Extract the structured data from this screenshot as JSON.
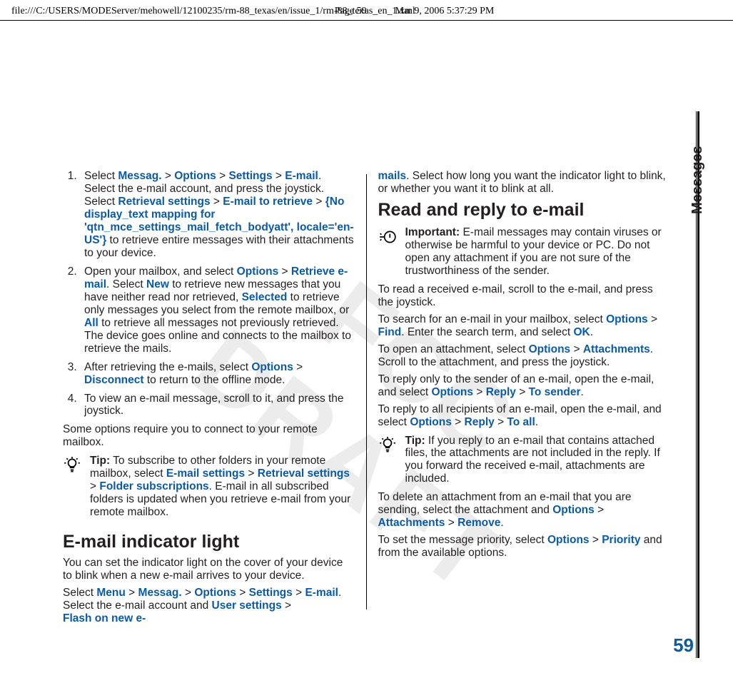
{
  "header": {
    "file_path": "file:///C:/USERS/MODEServer/mehowell/12100235/rm-88_texas/en/issue_1/rm-88_texas_en_1.xml",
    "page": "Page 59",
    "datetime": "Mar 9, 2006 5:37:29 PM"
  },
  "sidetab": "Messages",
  "page_number": "59",
  "watermark": "FCC DRAFT",
  "left_col": {
    "ol": [
      {
        "lead": "Select ",
        "path1": [
          "Messag.",
          "Options",
          "Settings",
          "E-mail"
        ],
        "after_path1": ". Select the e-mail account, and press the joystick. Select ",
        "path2": [
          "Retrieval settings",
          "E-mail to retrieve",
          "{No display_text mapping for 'qtn_mce_settings_mail_fetch_bodyatt', locale='en-US'}"
        ],
        "after_path2": " to retrieve entire messages with their attachments to your device."
      },
      {
        "lead": "Open your mailbox, and select ",
        "path1": [
          "Options",
          "Retrieve e-mail"
        ],
        "after_path1": ". Select ",
        "opt_new": "New",
        "after_new": " to retrieve new messages that you have neither read nor retrieved, ",
        "opt_sel": "Selected",
        "after_sel": " to retrieve only messages you select from the remote mailbox, or ",
        "opt_all": "All",
        "after_all": " to retrieve all messages not previously retrieved. The device goes online and connects to the mailbox to retrieve the mails."
      },
      {
        "lead": "After retrieving the e-mails, select ",
        "path1": [
          "Options",
          "Disconnect"
        ],
        "after_path1": " to return to the offline mode."
      },
      {
        "plain": "To view an e-mail message, scroll to it, and press the joystick."
      }
    ],
    "para_after_ol": "Some options require you to connect to your remote mailbox.",
    "tip": {
      "label": "Tip:",
      "before": " To subscribe to other folders in your remote mailbox, select ",
      "path": [
        "E-mail settings",
        "Retrieval settings",
        "Folder subscriptions"
      ],
      "after": ". E-mail in all subscribed folders is updated when you retrieve e-mail from your remote mailbox."
    },
    "sect2_title": "E-mail indicator light",
    "sect2_p1": "You can set the indicator light on the cover of your device to blink when a new e-mail arrives to your device.",
    "sect2_lead": "Select ",
    "sect2_path1": [
      "Menu",
      "Messag.",
      "Options",
      "Settings",
      "E-mail"
    ],
    "sect2_mid": ". Select the e-mail account and ",
    "sect2_path2": [
      "User settings",
      "Flash on new e-"
    ]
  },
  "right_col": {
    "cont_word": "mails",
    "cont_rest": ". Select how long you want the indicator light to blink, or whether you want it to blink at all.",
    "sect_title": "Read and reply to e-mail",
    "important_label": "Important:",
    "important_text": "  E-mail messages may contain viruses or otherwise be harmful to your device or PC. Do not open any attachment if you are not sure of the trustworthiness of the sender.",
    "p_read": "To read a received e-mail, scroll to the e-mail, and press the joystick.",
    "p_search_lead": "To search for an e-mail in your mailbox, select ",
    "p_search_path": [
      "Options",
      "Find"
    ],
    "p_search_mid": ". Enter the search term, and select ",
    "p_search_ok": "OK",
    "p_search_end": ".",
    "p_attach_lead": "To open an attachment, select ",
    "p_attach_path": [
      "Options",
      "Attachments"
    ],
    "p_attach_end": ". Scroll to the attachment, and press the joystick.",
    "p_reply1_lead": "To reply only to the sender of an e-mail, open the e-mail, and select ",
    "p_reply1_path": [
      "Options",
      "Reply",
      "To sender"
    ],
    "p_reply1_end": ".",
    "p_reply2_lead": "To reply to all recipients of an e-mail, open the e-mail, and select ",
    "p_reply2_path": [
      "Options",
      "Reply",
      "To all"
    ],
    "p_reply2_end": ".",
    "tip": {
      "label": "Tip:",
      "text": " If you reply to an e-mail that contains attached files, the attachments are not included in the reply. If you forward the received e-mail, attachments are included."
    },
    "p_del_lead": "To delete an attachment from an e-mail that you are sending, select the attachment and ",
    "p_del_path": [
      "Options",
      "Attachments",
      "Remove"
    ],
    "p_del_end": ".",
    "p_prio_lead": "To set the message priority, select ",
    "p_prio_path": [
      "Options",
      "Priority"
    ],
    "p_prio_end": " and from the available options."
  }
}
